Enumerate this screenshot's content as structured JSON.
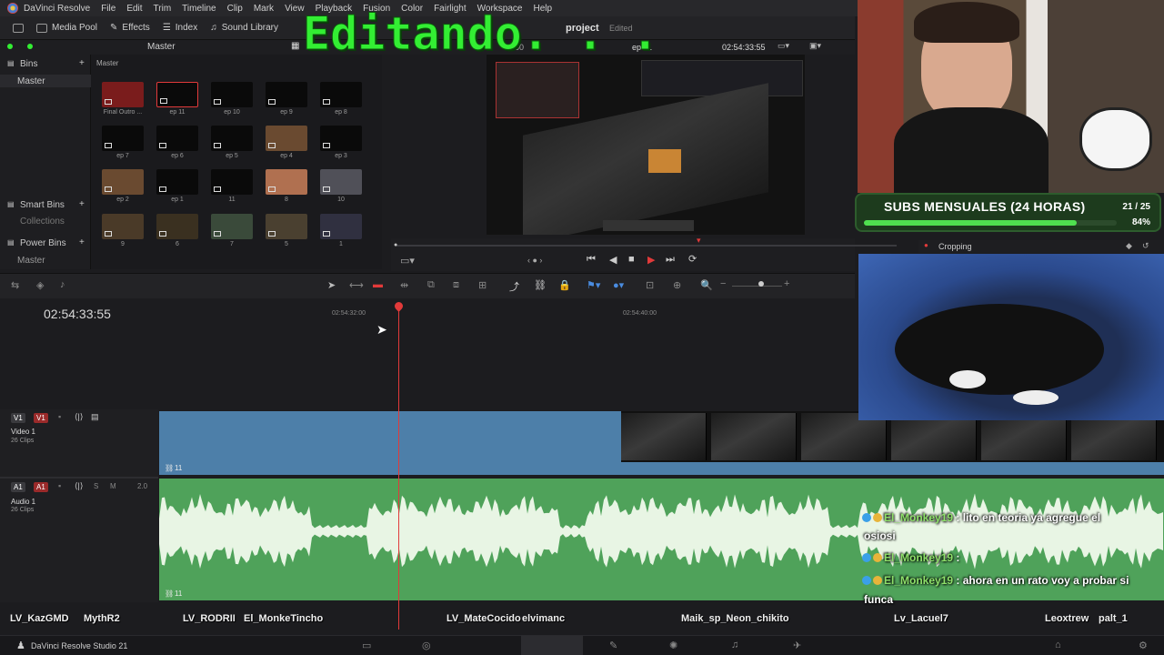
{
  "menubar": {
    "app_name": "DaVinci Resolve",
    "items": [
      "File",
      "Edit",
      "Trim",
      "Timeline",
      "Clip",
      "Mark",
      "View",
      "Playback",
      "Fusion",
      "Color",
      "Fairlight",
      "Workspace",
      "Help"
    ]
  },
  "toolbar": {
    "media_pool": "Media Pool",
    "effects": "Effects",
    "index": "Index",
    "sound_library": "Sound Library",
    "project_title": "project",
    "project_status": "Edited"
  },
  "media_pool": {
    "bin_title": "Master",
    "bins_label": "Bins",
    "master_bin": "Master",
    "path": "Master",
    "smart_bins": "Smart Bins",
    "collections": "Collections",
    "power_bins": "Power Bins",
    "power_master": "Master",
    "clips": [
      {
        "label": "Final Outro ..."
      },
      {
        "label": "ep 11"
      },
      {
        "label": "ep 10"
      },
      {
        "label": "ep 9"
      },
      {
        "label": "ep 8"
      },
      {
        "label": "ep 7"
      },
      {
        "label": "ep 6"
      },
      {
        "label": "ep 5"
      },
      {
        "label": "ep 4"
      },
      {
        "label": "ep 3"
      },
      {
        "label": "ep 2"
      },
      {
        "label": "ep 1"
      },
      {
        "label": "11"
      },
      {
        "label": "8"
      },
      {
        "label": "10"
      },
      {
        "label": "9"
      },
      {
        "label": "6"
      },
      {
        "label": "7"
      },
      {
        "label": "5"
      },
      {
        "label": "1"
      }
    ]
  },
  "viewer": {
    "timeline_name": "ep 11",
    "timecode": "02:54:33:55",
    "left_tc": "50",
    "overlay_title": "Editando. . ."
  },
  "timeline": {
    "timecode": "02:54:33:55",
    "ruler_marks": [
      "02:54:32:00",
      "02:54:40:00"
    ],
    "video_track": {
      "tag": "V1",
      "tag2": "V1",
      "name": "Video 1",
      "clips": "26 Clips",
      "clip_label": "11"
    },
    "audio_track": {
      "tag": "A1",
      "tag2": "A1",
      "name": "Audio 1",
      "clips": "26 Clips",
      "clip_label": "11",
      "level": "2.0",
      "solo": "S",
      "mute": "M"
    }
  },
  "subs_goal": {
    "title": "SUBS MENSUALES (24 HORAS)",
    "count": "21 / 25",
    "percent_label": "84%",
    "progress": 0.84
  },
  "cropping_label": "Cropping",
  "chat": [
    {
      "user": "El_Monkey19",
      "text": ": lito en teoria ya agregue el",
      "cont": "osiosi"
    },
    {
      "user": "El_Monkey19",
      "text": ":",
      "cont": ""
    },
    {
      "user": "El_Monkey19",
      "text": ": ahora en un rato voy a probar si",
      "cont": "funca"
    }
  ],
  "viewers": [
    "LV_KazGMD",
    "MythR2",
    "LV_RODRII",
    "El_MonkeTincho",
    "LV_MateCocido",
    "elvimanc",
    "Maik_sp_Neon_chikito",
    "Lv_Lacuel7",
    "Leoxtrew",
    "palt_1"
  ],
  "taskbar": {
    "app_label": "DaVinci Resolve Studio 21"
  },
  "colors": {
    "accent_green": "#33ee33",
    "video_clip": "#4d7fa9",
    "audio_clip": "#4fa25a",
    "playhead": "#e23a3a"
  }
}
